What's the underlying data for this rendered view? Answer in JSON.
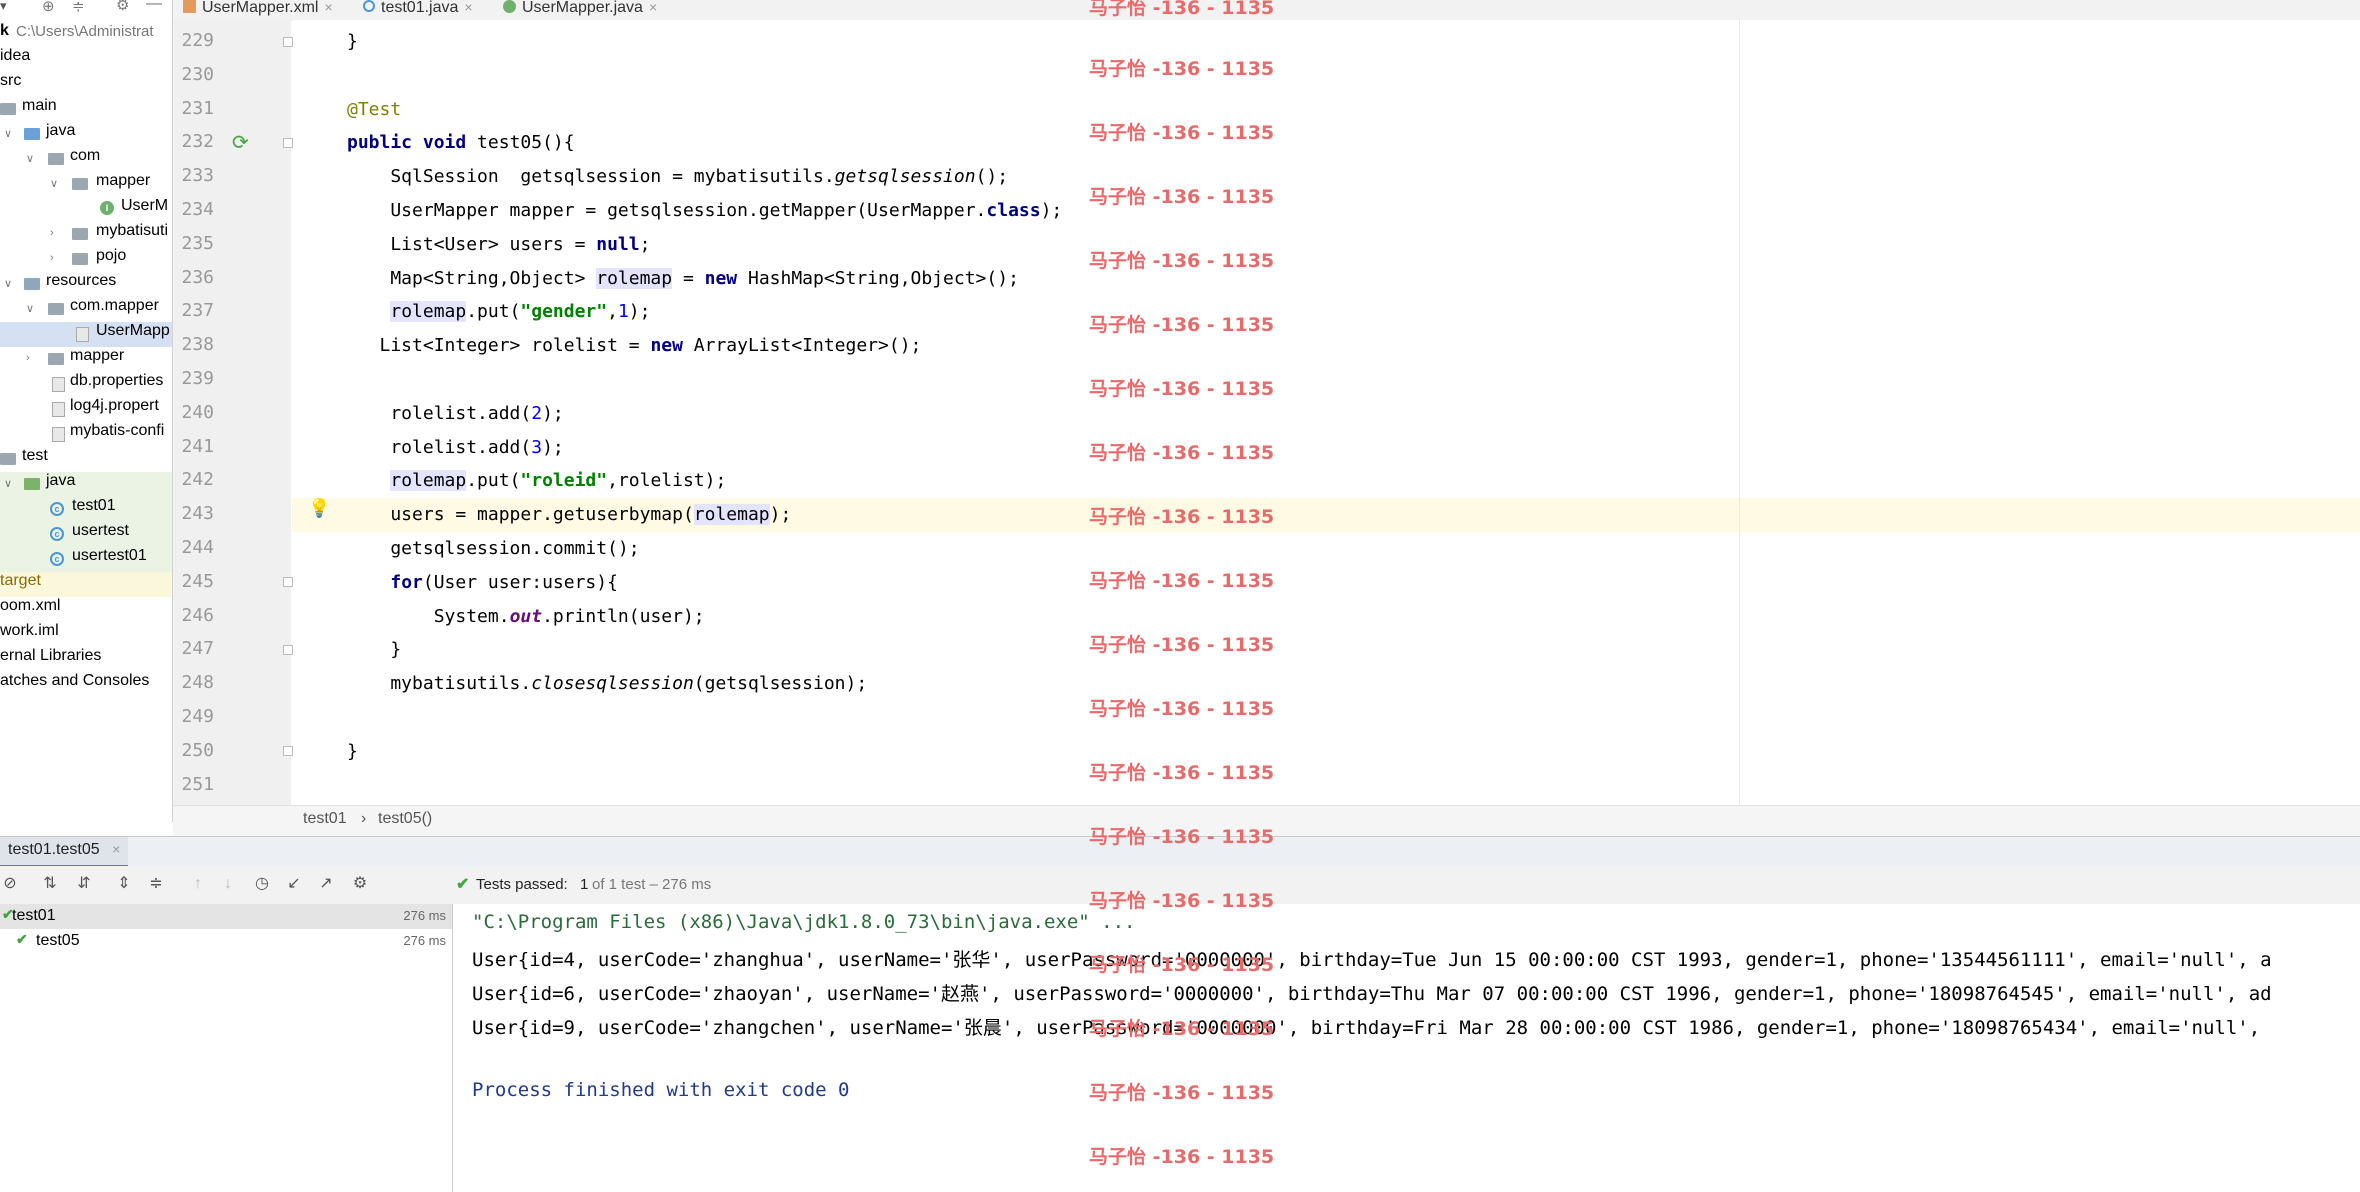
{
  "project": {
    "root_label": "k",
    "root_path": "C:\\Users\\Administrat",
    "items": [
      {
        "label": "idea"
      },
      {
        "label": "src"
      },
      {
        "label": "main"
      },
      {
        "label": "java"
      },
      {
        "label": "com"
      },
      {
        "label": "mapper"
      },
      {
        "label": "UserM"
      },
      {
        "label": "mybatisuti"
      },
      {
        "label": "pojo"
      },
      {
        "label": "resources"
      },
      {
        "label": "com.mapper"
      },
      {
        "label": "UserMapp"
      },
      {
        "label": "mapper"
      },
      {
        "label": "db.properties"
      },
      {
        "label": "log4j.propert"
      },
      {
        "label": "mybatis-confi"
      },
      {
        "label": "test"
      },
      {
        "label": "java"
      },
      {
        "label": "test01"
      },
      {
        "label": "usertest"
      },
      {
        "label": "usertest01"
      },
      {
        "label": "target"
      },
      {
        "label": "oom.xml"
      },
      {
        "label": "work.iml"
      },
      {
        "label": "ernal Libraries"
      },
      {
        "label": "atches and Consoles"
      }
    ]
  },
  "tabs": [
    {
      "label": "UserMapper.xml"
    },
    {
      "label": "test01.java"
    },
    {
      "label": "UserMapper.java"
    }
  ],
  "gutter": {
    "lines": [
      "229",
      "230",
      "231",
      "232",
      "233",
      "234",
      "235",
      "236",
      "237",
      "238",
      "239",
      "240",
      "241",
      "242",
      "243",
      "244",
      "245",
      "246",
      "247",
      "248",
      "249",
      "250",
      "251"
    ]
  },
  "watermark": "马子怡 -136 - 1135",
  "breadcrumb": {
    "class_name": "test01",
    "method": "test05()",
    "sep": "›"
  },
  "run": {
    "tab_label": "test01.test05",
    "status_prefix": "Tests passed:",
    "status_count": "1",
    "status_suffix": "of 1 test – 276 ms",
    "tree": [
      {
        "label": "test01",
        "time": "276 ms"
      },
      {
        "label": "test05",
        "time": "276 ms"
      }
    ],
    "console": [
      "\"C:\\Program Files (x86)\\Java\\jdk1.8.0_73\\bin\\java.exe\" ...",
      "User{id=4, userCode='zhanghua', userName='张华', userPassword='0000000', birthday=Tue Jun 15 00:00:00 CST 1993, gender=1, phone='13544561111', email='null', a",
      "User{id=6, userCode='zhaoyan', userName='赵燕', userPassword='0000000', birthday=Thu Mar 07 00:00:00 CST 1996, gender=1, phone='18098764545', email='null', ad",
      "User{id=9, userCode='zhangchen', userName='张晨', userPassword='0000000', birthday=Fri Mar 28 00:00:00 CST 1986, gender=1, phone='18098765434', email='null', ",
      "",
      "Process finished with exit code 0"
    ]
  },
  "colors": {
    "accent": "#4083c9",
    "caret_line": "#fffae3",
    "watermark": "#e86a6a",
    "pass": "#3fa63f"
  }
}
